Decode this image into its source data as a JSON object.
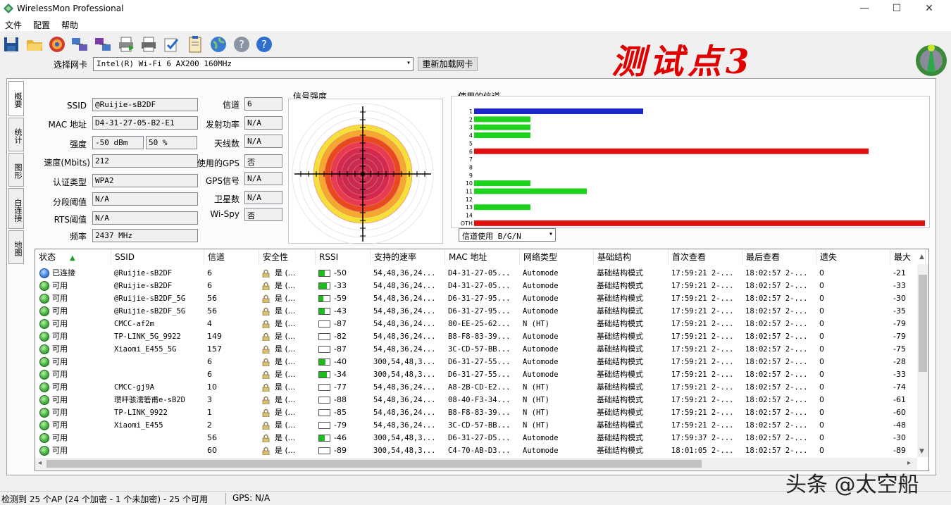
{
  "window": {
    "title": "WirelessMon Professional",
    "minimize": "—",
    "maximize": "☐",
    "close": "✕"
  },
  "menu": [
    "文件",
    "配置",
    "帮助"
  ],
  "toolbar_icons": [
    "save-icon",
    "open-folder-icon",
    "target-icon",
    "network-icon-1",
    "network-icon-2",
    "printer-icon-1",
    "printer-icon-2",
    "check-icon",
    "clipboard-icon",
    "globe-icon",
    "help-icon-gray",
    "help-icon-blue"
  ],
  "adapter": {
    "label": "选择网卡",
    "value": "Intel(R) Wi-Fi 6 AX200 160MHz",
    "reload": "重新加载网卡"
  },
  "watermark": "测试点3",
  "tabs": [
    "概要",
    "统计",
    "图形",
    "白连接",
    "地图"
  ],
  "summary": {
    "ssid_label": "SSID",
    "ssid": "@Ruijie-sB2DF",
    "mac_label": "MAC 地址",
    "mac": "D4-31-27-05-B2-E1",
    "strength_label": "强度",
    "strength_dbm": "-50 dBm",
    "strength_pct": "50 %",
    "speed_label": "速度(Mbits)",
    "speed": "212",
    "auth_label": "认证类型",
    "auth": "WPA2",
    "frag_label": "分段阈值",
    "frag": "N/A",
    "rts_label": "RTS阈值",
    "rts": "N/A",
    "freq_label": "频率",
    "freq": "2437 MHz",
    "channel_label": "信道",
    "channel": "6",
    "txpower_label": "发射功率",
    "txpower": "N/A",
    "antennas_label": "天线数",
    "antennas": "N/A",
    "gps_used_label": "使用的GPS",
    "gps_used": "否",
    "gps_signal_label": "GPS信号",
    "gps_signal": "N/A",
    "satellites_label": "卫星数",
    "satellites": "N/A",
    "wispy_label": "Wi-Spy",
    "wispy": "否"
  },
  "signal_strength": {
    "title": "信号强度",
    "level_pct": 50
  },
  "channels": {
    "title": "使用的信道",
    "select_value": "信道使用 B/G/N",
    "rows": [
      {
        "label": "1",
        "value": 3,
        "color": "#1c28c8"
      },
      {
        "label": "2",
        "value": 1,
        "color": "#1ed21e"
      },
      {
        "label": "3",
        "value": 1,
        "color": "#1ed21e"
      },
      {
        "label": "4",
        "value": 1,
        "color": "#1ed21e"
      },
      {
        "label": "5",
        "value": 0,
        "color": "#1ed21e"
      },
      {
        "label": "6",
        "value": 7,
        "color": "#e01010"
      },
      {
        "label": "7",
        "value": 0,
        "color": "#1ed21e"
      },
      {
        "label": "8",
        "value": 0,
        "color": "#1ed21e"
      },
      {
        "label": "9",
        "value": 0,
        "color": "#1ed21e"
      },
      {
        "label": "10",
        "value": 1,
        "color": "#1ed21e"
      },
      {
        "label": "11",
        "value": 2,
        "color": "#1ed21e"
      },
      {
        "label": "12",
        "value": 0,
        "color": "#1ed21e"
      },
      {
        "label": "13",
        "value": 1,
        "color": "#1ed21e"
      },
      {
        "label": "14",
        "value": 0,
        "color": "#1ed21e"
      },
      {
        "label": "OTH",
        "value": 8,
        "color": "#e01010"
      }
    ]
  },
  "table": {
    "columns": [
      "状态",
      "SSID",
      "信道",
      "安全性",
      "RSSI",
      "支持的速率",
      "MAC 地址",
      "网络类型",
      "基础结构",
      "首次查看",
      "最后查看",
      "遗失",
      "最大"
    ],
    "rows": [
      {
        "status": "已连接",
        "connected": true,
        "ssid": "@Ruijie-sB2DF",
        "channel": "6",
        "security": "是 (...",
        "rssi": "-50",
        "rssi_level": 0.5,
        "rates": "54,48,36,24...",
        "mac": "D4-31-27-05...",
        "nettype": "Automode",
        "infra": "基础结构模式",
        "first": "17:59:21 2-...",
        "last": "18:02:57 2-...",
        "lost": "0",
        "max": "-21"
      },
      {
        "status": "可用",
        "connected": false,
        "ssid": "@Ruijie-sB2DF",
        "channel": "6",
        "security": "是 (...",
        "rssi": "-33",
        "rssi_level": 0.7,
        "rates": "54,48,36,24...",
        "mac": "D4-31-27-05...",
        "nettype": "Automode",
        "infra": "基础结构模式",
        "first": "17:59:21 2-...",
        "last": "18:02:57 2-...",
        "lost": "0",
        "max": "-33"
      },
      {
        "status": "可用",
        "connected": false,
        "ssid": "@Ruijie-sB2DF_5G",
        "channel": "56",
        "security": "是 (...",
        "rssi": "-59",
        "rssi_level": 0.4,
        "rates": "54,48,36,24...",
        "mac": "D6-31-27-95...",
        "nettype": "Automode",
        "infra": "基础结构模式",
        "first": "17:59:21 2-...",
        "last": "18:02:57 2-...",
        "lost": "0",
        "max": "-30"
      },
      {
        "status": "可用",
        "connected": false,
        "ssid": "@Ruijie-sB2DF_5G",
        "channel": "56",
        "security": "是 (...",
        "rssi": "-43",
        "rssi_level": 0.55,
        "rates": "54,48,36,24...",
        "mac": "D6-31-27-95...",
        "nettype": "Automode",
        "infra": "基础结构模式",
        "first": "17:59:21 2-...",
        "last": "18:02:57 2-...",
        "lost": "0",
        "max": "-35"
      },
      {
        "status": "可用",
        "connected": false,
        "ssid": "CMCC-af2m",
        "channel": "4",
        "security": "是 (...",
        "rssi": "-87",
        "rssi_level": 0,
        "rates": "54,48,36,24...",
        "mac": "80-EE-25-62...",
        "nettype": "N (HT)",
        "infra": "基础结构模式",
        "first": "17:59:21 2-...",
        "last": "18:02:57 2-...",
        "lost": "0",
        "max": "-79"
      },
      {
        "status": "可用",
        "connected": false,
        "ssid": "TP-LINK_5G_9922",
        "channel": "149",
        "security": "是 (...",
        "rssi": "-82",
        "rssi_level": 0,
        "rates": "54,48,36,24...",
        "mac": "B8-F8-83-39...",
        "nettype": "Automode",
        "infra": "基础结构模式",
        "first": "17:59:21 2-...",
        "last": "18:02:57 2-...",
        "lost": "0",
        "max": "-79"
      },
      {
        "status": "可用",
        "connected": false,
        "ssid": "Xiaomi_E455_5G",
        "channel": "157",
        "security": "是 (...",
        "rssi": "-87",
        "rssi_level": 0,
        "rates": "54,48,36,24...",
        "mac": "3C-CD-57-BB...",
        "nettype": "Automode",
        "infra": "基础结构模式",
        "first": "17:59:21 2-...",
        "last": "18:02:57 2-...",
        "lost": "0",
        "max": "-75"
      },
      {
        "status": "可用",
        "connected": false,
        "ssid": "",
        "channel": "6",
        "security": "是 (...",
        "rssi": "-40",
        "rssi_level": 0.6,
        "rates": "300,54,48,3...",
        "mac": "D6-31-27-55...",
        "nettype": "Automode",
        "infra": "基础结构模式",
        "first": "17:59:21 2-...",
        "last": "18:02:57 2-...",
        "lost": "0",
        "max": "-28"
      },
      {
        "status": "可用",
        "connected": false,
        "ssid": "",
        "channel": "6",
        "security": "是 (...",
        "rssi": "-34",
        "rssi_level": 0.7,
        "rates": "300,54,48,3...",
        "mac": "D6-31-27-55...",
        "nettype": "Automode",
        "infra": "基础结构模式",
        "first": "17:59:21 2-...",
        "last": "18:02:57 2-...",
        "lost": "0",
        "max": "-33"
      },
      {
        "status": "可用",
        "connected": false,
        "ssid": "CMCC-gj9A",
        "channel": "10",
        "security": "是 (...",
        "rssi": "-77",
        "rssi_level": 0,
        "rates": "54,48,36,24...",
        "mac": "A8-2B-CD-E2...",
        "nettype": "N (HT)",
        "infra": "基础结构模式",
        "first": "17:59:21 2-...",
        "last": "18:02:57 2-...",
        "lost": "0",
        "max": "-74"
      },
      {
        "status": "可用",
        "connected": false,
        "ssid": "瓒呯骇濡箬甫e-sB2D",
        "channel": "3",
        "security": "是 (...",
        "rssi": "-88",
        "rssi_level": 0,
        "rates": "54,48,36,24...",
        "mac": "08-40-F3-34...",
        "nettype": "N (HT)",
        "infra": "基础结构模式",
        "first": "17:59:21 2-...",
        "last": "18:02:57 2-...",
        "lost": "0",
        "max": "-61"
      },
      {
        "status": "可用",
        "connected": false,
        "ssid": "TP-LINK_9922",
        "channel": "1",
        "security": "是 (...",
        "rssi": "-85",
        "rssi_level": 0,
        "rates": "54,48,36,24...",
        "mac": "B8-F8-83-39...",
        "nettype": "N (HT)",
        "infra": "基础结构模式",
        "first": "17:59:21 2-...",
        "last": "18:02:57 2-...",
        "lost": "0",
        "max": "-60"
      },
      {
        "status": "可用",
        "connected": false,
        "ssid": "Xiaomi_E455",
        "channel": "2",
        "security": "是 (...",
        "rssi": "-79",
        "rssi_level": 0,
        "rates": "54,48,36,24...",
        "mac": "3C-CD-57-BB...",
        "nettype": "N (HT)",
        "infra": "基础结构模式",
        "first": "17:59:21 2-...",
        "last": "18:02:57 2-...",
        "lost": "0",
        "max": "-48"
      },
      {
        "status": "可用",
        "connected": false,
        "ssid": "",
        "channel": "56",
        "security": "是 (...",
        "rssi": "-46",
        "rssi_level": 0.55,
        "rates": "300,54,48,3...",
        "mac": "D6-31-27-D5...",
        "nettype": "Automode",
        "infra": "基础结构模式",
        "first": "17:59:37 2-...",
        "last": "18:02:57 2-...",
        "lost": "0",
        "max": "-30"
      },
      {
        "status": "可用",
        "connected": false,
        "ssid": "",
        "channel": "60",
        "security": "是 (...",
        "rssi": "-89",
        "rssi_level": 0,
        "rates": "300,54,48,3...",
        "mac": "C4-70-AB-D3...",
        "nettype": "Automode",
        "infra": "基础结构模式",
        "first": "18:01:05 2-...",
        "last": "18:02:57 2-...",
        "lost": "0",
        "max": "-89"
      }
    ]
  },
  "status": {
    "text": "检测到 25 个AP (24 个加密 - 1 个未加密) - 25 个可用",
    "gps": "GPS: N/A"
  },
  "credit": "头条 @太空船"
}
